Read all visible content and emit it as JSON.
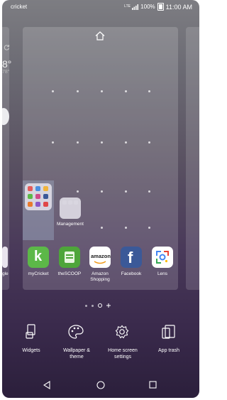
{
  "status_bar": {
    "carrier": "cricket",
    "network": "LTE",
    "battery": "100%",
    "time": "11:00 AM"
  },
  "left_page": {
    "temp_partial": "8°",
    "temp_sub_partial": "78°",
    "app_label_partial": "gle"
  },
  "home_screen": {
    "folders": [
      {
        "label": ""
      },
      {
        "label": "Management"
      }
    ],
    "dock_apps": [
      {
        "label": "myCricket",
        "icon": "mycricket-icon"
      },
      {
        "label": "theSCOOP",
        "icon": "thescoop-icon"
      },
      {
        "label": "Amazon Shopping",
        "icon": "amazon-icon",
        "badge_text": "amazon"
      },
      {
        "label": "Facebook",
        "icon": "facebook-icon",
        "badge_text": "f"
      },
      {
        "label": "Lens",
        "icon": "lens-icon"
      }
    ]
  },
  "options": [
    {
      "label": "Widgets",
      "icon": "widgets-icon"
    },
    {
      "label": "Wallpaper & theme",
      "icon": "palette-icon"
    },
    {
      "label": "Home screen settings",
      "icon": "gear-icon"
    },
    {
      "label": "App trash",
      "icon": "app-trash-icon"
    }
  ],
  "nav_bar": {
    "icons": [
      "back-icon",
      "home-icon",
      "recents-icon"
    ]
  },
  "colors": {
    "mycricket": "#5cb848",
    "thescoop": "#4ea53a",
    "facebook": "#3b5998",
    "amazon_bg": "#ffffff"
  }
}
